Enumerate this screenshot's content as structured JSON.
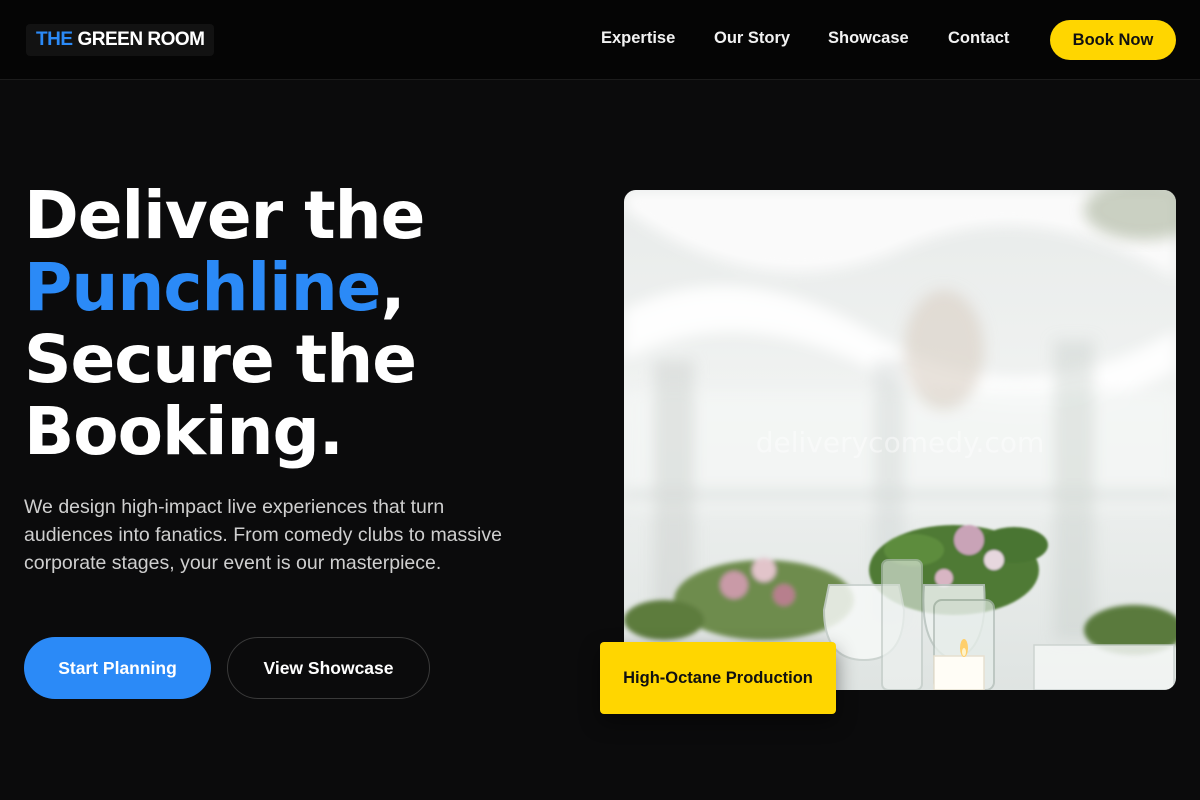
{
  "brand": {
    "logo_part1": "THE",
    "logo_part2": "GREEN ROOM"
  },
  "nav": {
    "items": [
      {
        "label": "Expertise"
      },
      {
        "label": "Our Story"
      },
      {
        "label": "Showcase"
      },
      {
        "label": "Contact"
      }
    ],
    "cta_label": "Book Now"
  },
  "hero": {
    "headline_line1": "Deliver the",
    "headline_accent": "Punchline",
    "headline_comma": ",",
    "headline_line3": "Secure the",
    "headline_line4": "Booking.",
    "description": "We design high-impact live experiences that turn audiences into fanatics. From comedy clubs to massive corporate stages, your event is our masterpiece.",
    "primary_button": "Start Planning",
    "secondary_button": "View Showcase",
    "image_watermark": "deliverycomedy.com",
    "badge_label": "High-Octane Production"
  },
  "colors": {
    "accent_blue": "#2b8af7",
    "accent_yellow": "#ffd600",
    "background": "#0b0b0c"
  }
}
